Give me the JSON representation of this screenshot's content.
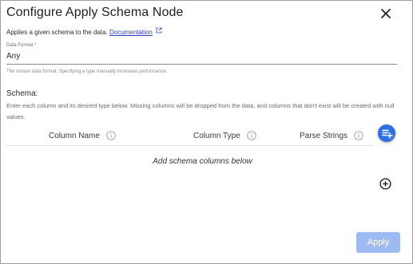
{
  "dialog": {
    "title": "Configure Apply Schema Node",
    "close_icon": "close-icon",
    "description": "Applies a given schema to the data.",
    "documentation_link": "Documentation",
    "external_link_icon": "external-link-icon"
  },
  "data_format": {
    "label": "Data Format *",
    "value": "Any",
    "helper": "The stream data format. Specifying a type manually increases performance."
  },
  "schema": {
    "heading": "Schema:",
    "description": "Enter each column and its desired type below. Missing columns will be dropped from the data, and columns that don't exist will be created with null values.",
    "columns": [
      {
        "label": "Column Name",
        "icon": "info-icon"
      },
      {
        "label": "Column Type",
        "icon": "info-icon"
      },
      {
        "label": "Parse Strings",
        "icon": "info-icon"
      }
    ],
    "add_columns_icon": "playlist-add-icon",
    "empty_text": "Add schema columns below",
    "add_row_icon": "add-circle-icon"
  },
  "footer": {
    "apply_label": "Apply",
    "apply_disabled": true
  },
  "colors": {
    "accent": "#2f6fe4",
    "apply_disabled_bg": "#9dbbf0",
    "link": "#2f3ec9"
  }
}
